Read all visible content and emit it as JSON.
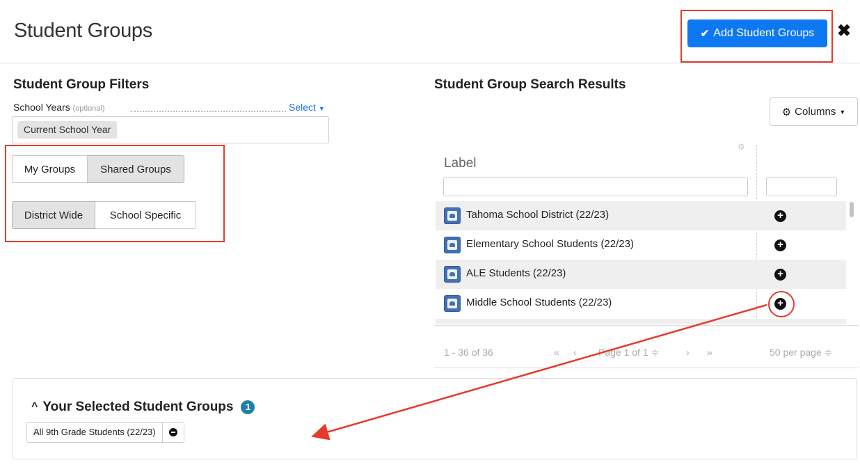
{
  "header": {
    "title": "Student Groups",
    "add_button": "Add Student Groups",
    "close": "✖"
  },
  "filters": {
    "title": "Student Group Filters",
    "school_years_label": "School Years",
    "optional_hint": "(optional)",
    "select_link": "Select",
    "selected_year": "Current School Year",
    "ownership": [
      {
        "label": "My Groups",
        "active": false
      },
      {
        "label": "Shared Groups",
        "active": true
      }
    ],
    "scope": [
      {
        "label": "District Wide",
        "active": true
      },
      {
        "label": "School Specific",
        "active": false
      }
    ]
  },
  "results": {
    "title": "Student Group Search Results",
    "columns_button": "Columns",
    "column_label": "Label",
    "rows": [
      {
        "label": "Tahoma School District (22/23)"
      },
      {
        "label": "Elementary School Students (22/23)"
      },
      {
        "label": "ALE Students (22/23)"
      },
      {
        "label": "Middle School Students (22/23)"
      }
    ],
    "pager": {
      "count": "1 - 36 of 36",
      "first": "«",
      "prev": "‹",
      "page": "Page 1 of 1 ≑",
      "next": "›",
      "last": "»",
      "per_page": "50 per page ≑"
    }
  },
  "selected": {
    "title": "Your Selected Student Groups",
    "count": "1",
    "items": [
      {
        "label": "All 9th Grade Students (22/23)"
      }
    ]
  },
  "colors": {
    "primary": "#0d78f2",
    "highlight": "#e53b2c",
    "badge": "#1f7fa8"
  }
}
